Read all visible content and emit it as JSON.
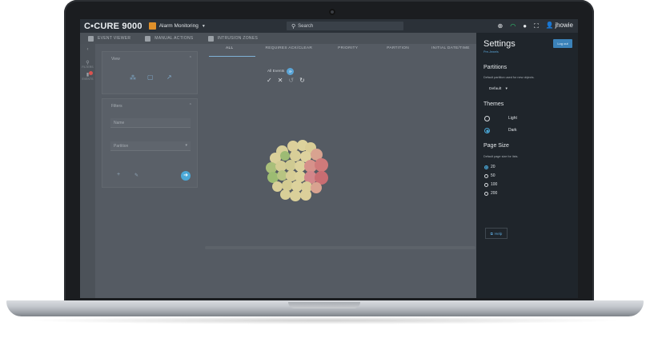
{
  "topbar": {
    "brand": "C•CURE 9000",
    "app_name": "Alarm Monitoring",
    "search_placeholder": "Search",
    "username": "jhowie"
  },
  "tabs": [
    {
      "label": "EVENT VIEWER"
    },
    {
      "label": "MANUAL ACTIONS"
    },
    {
      "label": "INTRUSION ZONES"
    }
  ],
  "rail": {
    "items": [
      {
        "label": "FILTERS"
      },
      {
        "label": "EVENTS"
      }
    ]
  },
  "view_panel": {
    "title": "View"
  },
  "filters_panel": {
    "title": "Filters",
    "name_placeholder": "Name",
    "partition_placeholder": "Partition"
  },
  "filters": [
    {
      "label": "ALL",
      "active": true
    },
    {
      "label": "REQUIRES ACK/CLEAR"
    },
    {
      "label": "PRIORITY"
    },
    {
      "label": "PARTITION"
    },
    {
      "label": "INITIAL DATE/TIME"
    },
    {
      "label": "LAST A"
    }
  ],
  "events": {
    "label": "All Events"
  },
  "settings": {
    "title": "Settings",
    "subtitle": "Pre-Jewels",
    "logout_label": "Log out",
    "partitions": {
      "heading": "Partitions",
      "description": "Default partition used for new objects.",
      "selected": "Default"
    },
    "themes": {
      "heading": "Themes",
      "options": [
        {
          "label": "Light",
          "selected": false
        },
        {
          "label": "Dark",
          "selected": true
        }
      ]
    },
    "page_size": {
      "heading": "Page Size",
      "description": "Default page size for lists.",
      "options": [
        {
          "label": "20",
          "selected": true
        },
        {
          "label": "50",
          "selected": false
        },
        {
          "label": "100",
          "selected": false
        },
        {
          "label": "200",
          "selected": false
        }
      ]
    },
    "help_label": "Help"
  },
  "colors": {
    "accent": "#4aa8d8",
    "drawer_bg": "#1f252b",
    "wifi": "#2ecc71",
    "app_icon": "#e0902a"
  }
}
